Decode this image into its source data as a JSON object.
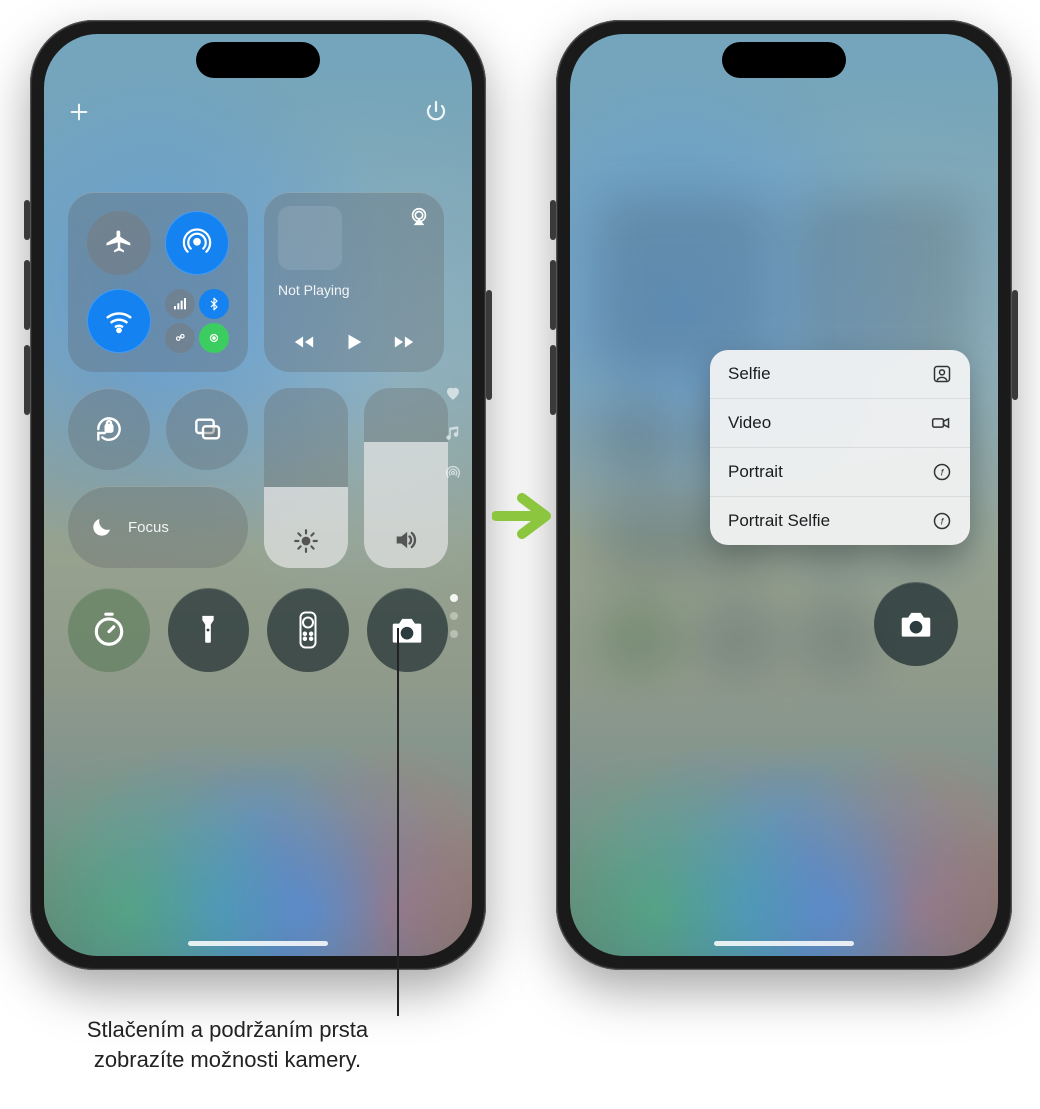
{
  "phoneA": {
    "header": {
      "add_icon": "plus",
      "power_icon": "power"
    },
    "connectivity": {
      "airplane": {
        "name": "airplane-mode",
        "on": false
      },
      "airdrop": {
        "name": "airdrop",
        "on": true
      },
      "wifi": {
        "name": "wifi",
        "on": true
      },
      "cellular": {
        "name": "cellular-data",
        "on": true
      },
      "bluetooth": {
        "name": "bluetooth",
        "on": true
      },
      "hotspot": {
        "name": "personal-hotspot",
        "on": false
      },
      "satellite": {
        "name": "satellite",
        "on": true
      }
    },
    "now_playing": {
      "airplay_icon": "airplay",
      "status_text": "Not Playing",
      "controls": {
        "prev": "previous-track",
        "play": "play",
        "next": "next-track"
      }
    },
    "orientation_lock": "rotation-lock",
    "screen_mirroring": "screen-mirroring",
    "focus": {
      "icon": "moon",
      "label": "Focus"
    },
    "brightness": {
      "icon": "sun",
      "level_pct": 45
    },
    "volume": {
      "icon": "volume",
      "level_pct": 70
    },
    "side_glyphs": [
      "heart",
      "music",
      "hotspot"
    ],
    "actions": {
      "timer": "timer",
      "flashlight": "flashlight",
      "remote": "apple-tv-remote",
      "camera": "camera"
    },
    "page_dots": {
      "count": 3,
      "active": 0
    }
  },
  "phoneB": {
    "menu": {
      "items": [
        {
          "label": "Selfie",
          "icon": "person-square"
        },
        {
          "label": "Video",
          "icon": "video-camera"
        },
        {
          "label": "Portrait",
          "icon": "aperture"
        },
        {
          "label": "Portrait Selfie",
          "icon": "aperture"
        }
      ]
    },
    "camera_button_icon": "camera"
  },
  "callout": {
    "line1": "Stlačením a podržaním prsta",
    "line2": "zobrazíte možnosti kamery."
  }
}
